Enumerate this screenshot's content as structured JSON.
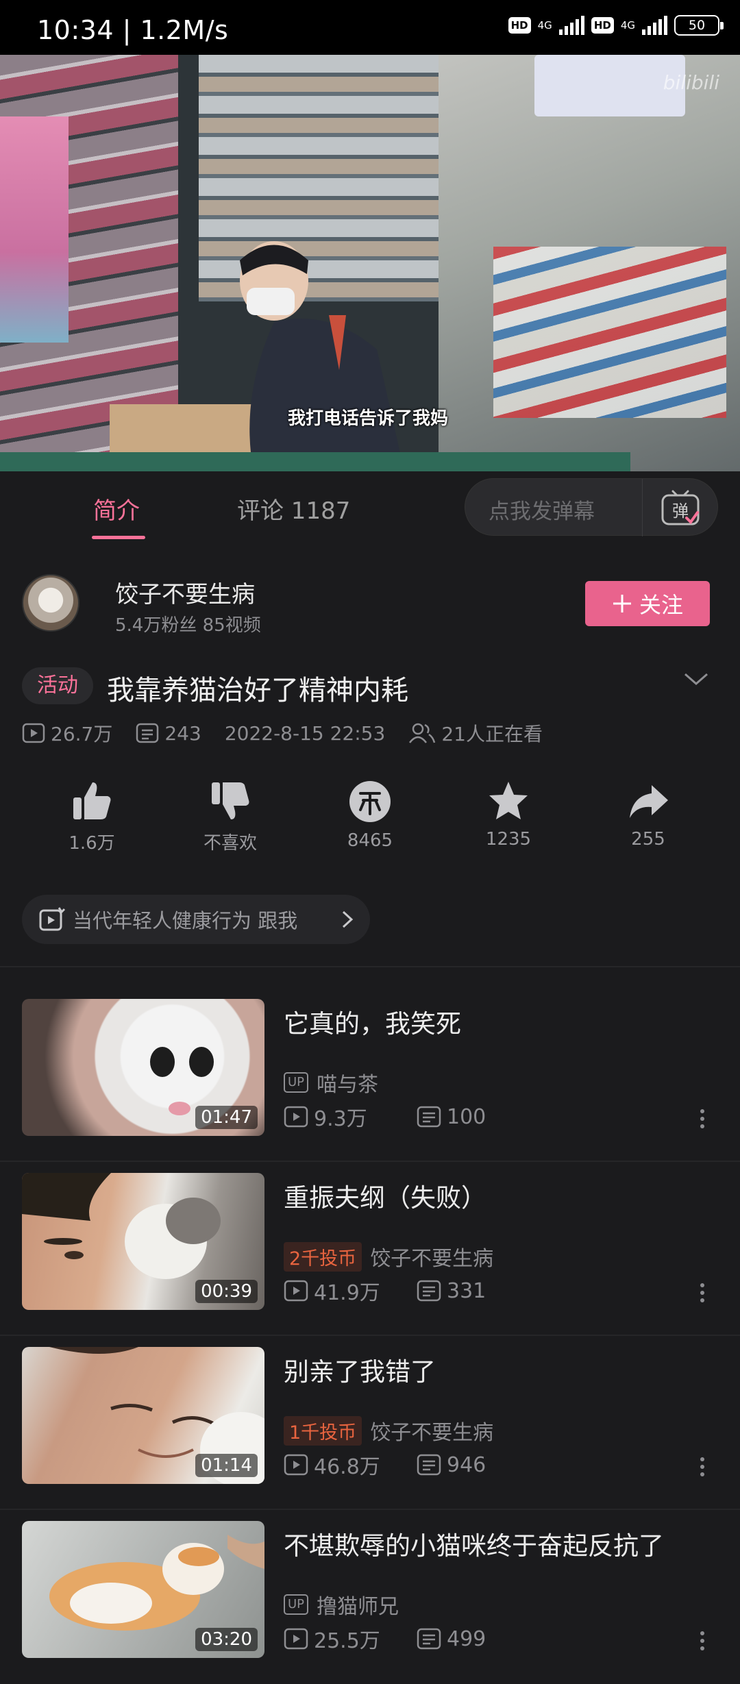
{
  "status_bar": {
    "time": "10:34 | 1.2M/s",
    "hd1": "HD",
    "net1": "4G",
    "hd2": "HD",
    "net2": "4G",
    "battery": "50"
  },
  "video": {
    "subtitle": "我打电话告诉了我妈",
    "watermark": "bilibili",
    "progress_fraction": 0.09
  },
  "tabs": {
    "intro": "简介",
    "comments": "评论 1187"
  },
  "danmu": {
    "placeholder": "点我发弹幕",
    "button_glyph": "弹"
  },
  "uploader": {
    "name": "饺子不要生病",
    "stats": "5.4万粉丝   85视频",
    "follow_label": "关注"
  },
  "video_info": {
    "tag": "活动",
    "title": "我靠养猫治好了精神内耗",
    "views": "26.7万",
    "danmaku": "243",
    "date": "2022-8-15 22:53",
    "watching": "21人正在看"
  },
  "actions": [
    {
      "label": "1.6万"
    },
    {
      "label": "不喜欢"
    },
    {
      "label": "8465"
    },
    {
      "label": "1235"
    },
    {
      "label": "255"
    }
  ],
  "related_topic": "当代年轻人健康行为    跟我",
  "accent": "#fb7299",
  "related": [
    {
      "title": "它真的，我笑死",
      "badge": "UP",
      "author": "喵与茶",
      "views": "9.3万",
      "danmaku": "100",
      "duration": "01:47"
    },
    {
      "title": "重振夫纲（失败）",
      "badge": "2千投币",
      "author": "饺子不要生病",
      "views": "41.9万",
      "danmaku": "331",
      "duration": "00:39"
    },
    {
      "title": "别亲了我错了",
      "badge": "1千投币",
      "author": "饺子不要生病",
      "views": "46.8万",
      "danmaku": "946",
      "duration": "01:14"
    },
    {
      "title": "不堪欺辱的小猫咪终于奋起反抗了",
      "badge": "UP",
      "author": "撸猫师兄",
      "views": "25.5万",
      "danmaku": "499",
      "duration": "03:20"
    }
  ]
}
